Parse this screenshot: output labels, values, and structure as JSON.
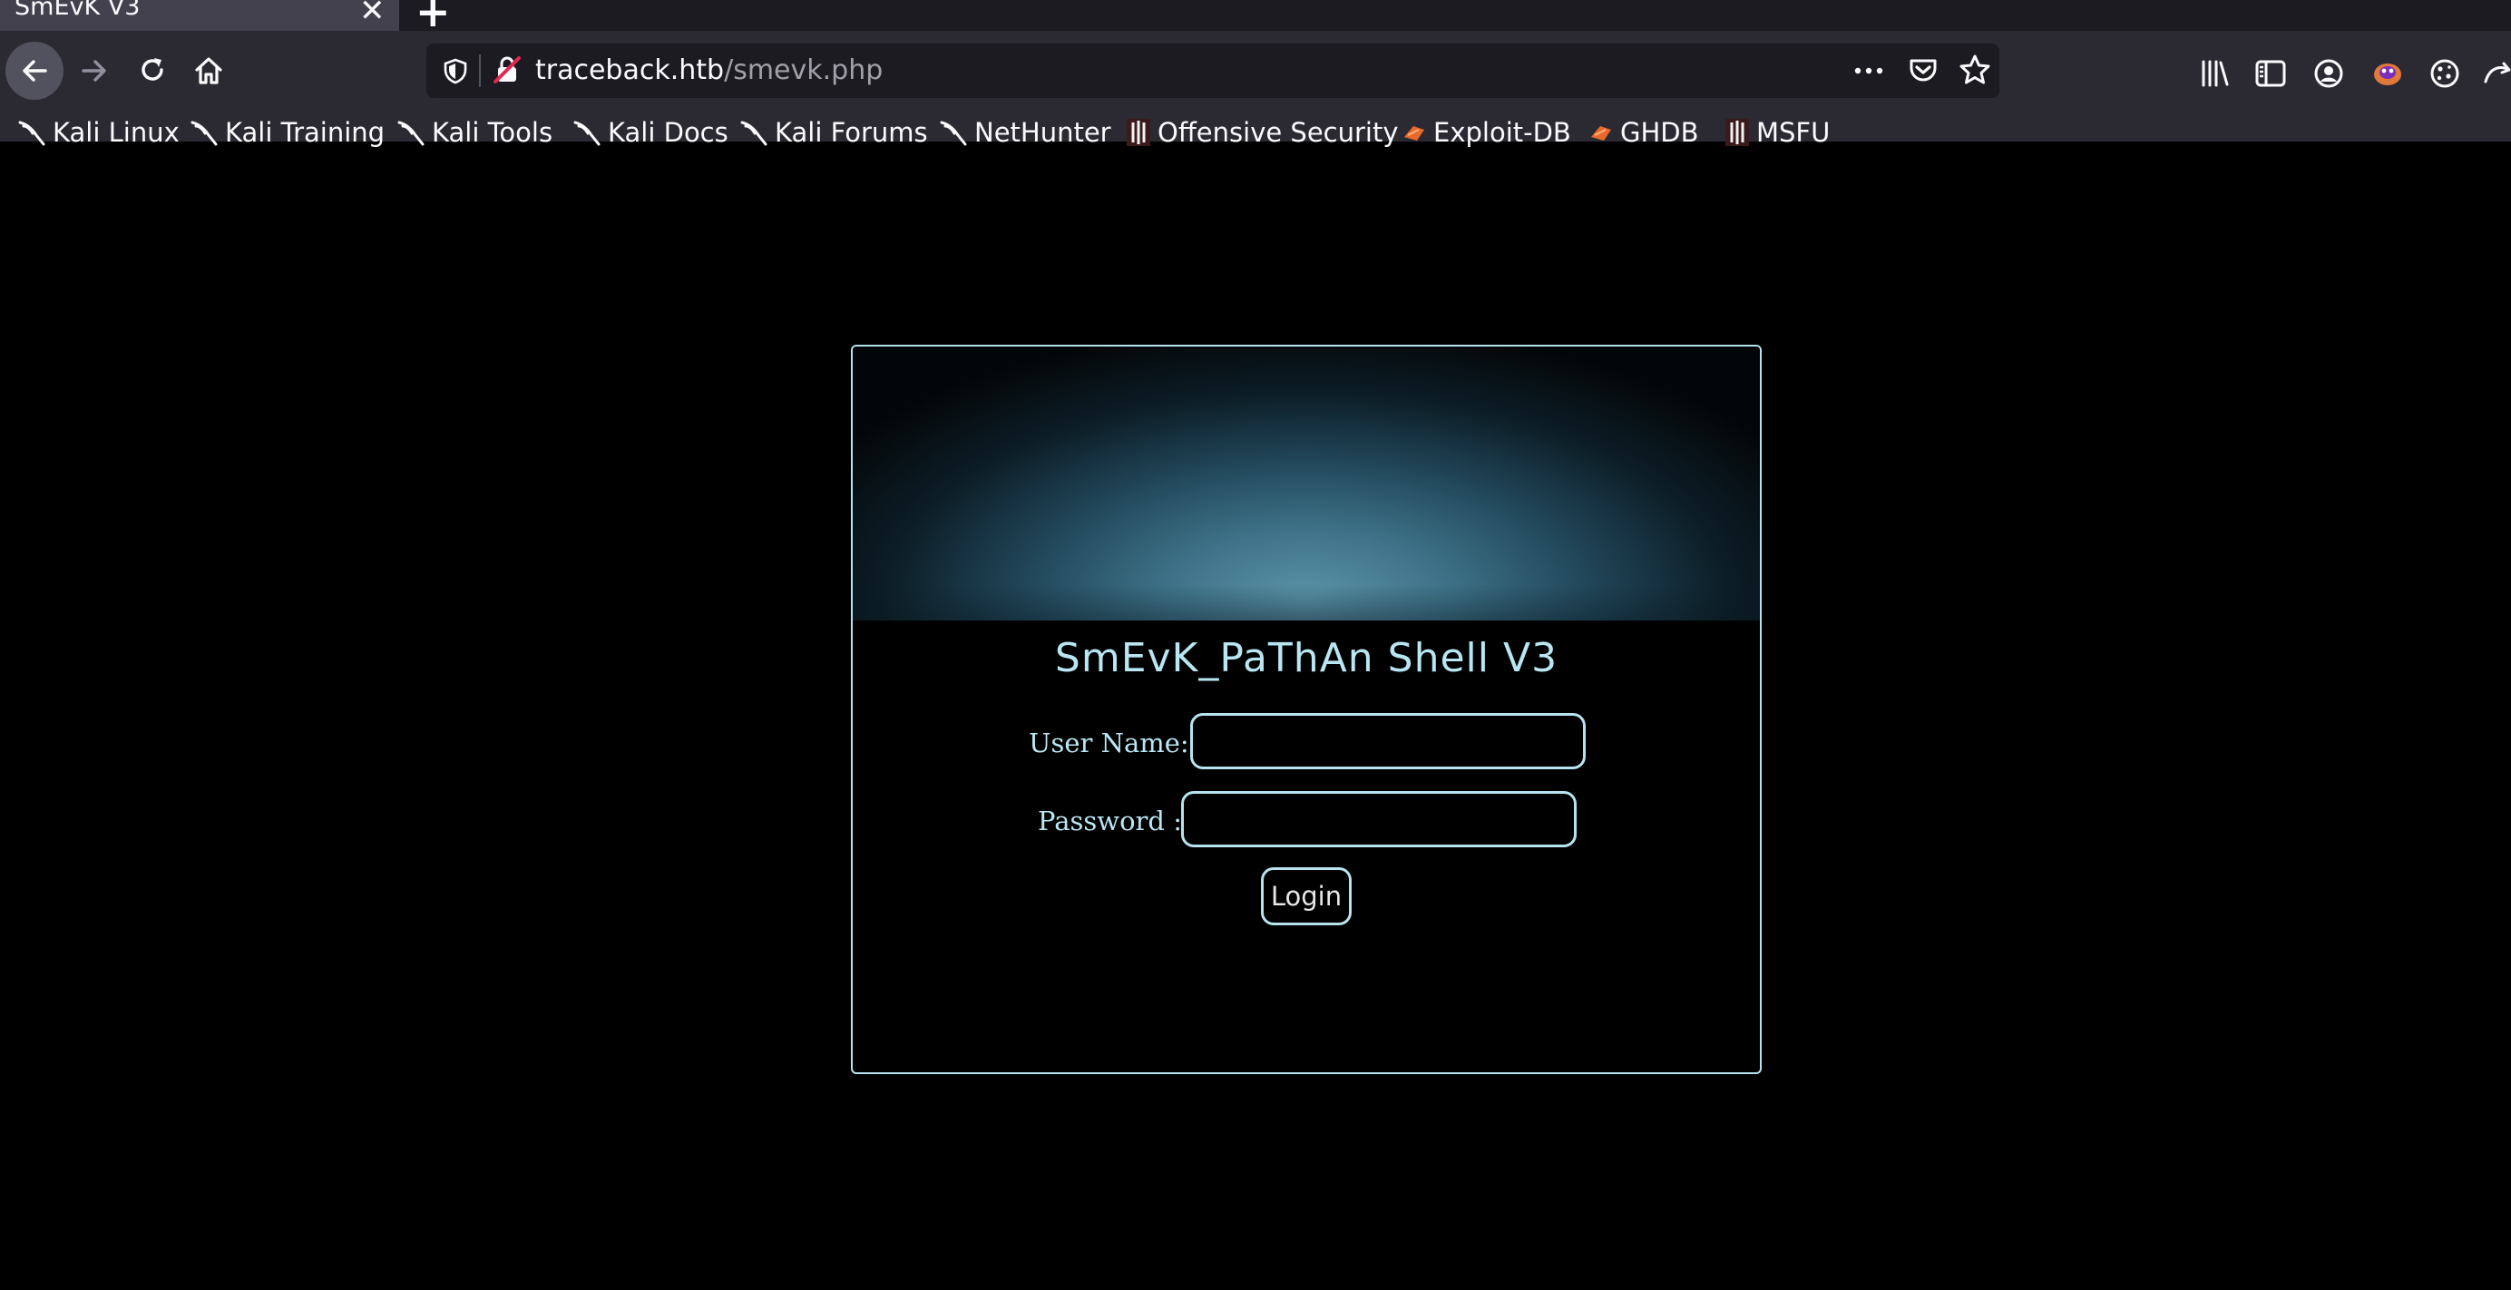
{
  "browser": {
    "tab": {
      "title": "SmEvK V3"
    },
    "url": {
      "host": "traceback.htb",
      "path": "/smevk.php"
    },
    "icons": [
      "back-arrow-icon",
      "forward-arrow-icon",
      "reload-icon",
      "home-icon",
      "shield-icon",
      "insecure-lock-icon",
      "more-actions-icon",
      "pocket-icon",
      "star-icon",
      "library-icon",
      "sidebar-icon",
      "account-icon",
      "extension-icon",
      "cookie-icon",
      "overflow-icon"
    ]
  },
  "bookmarks": [
    {
      "label": "Kali Linux",
      "icon": "kali-dragon-icon"
    },
    {
      "label": "Kali Training",
      "icon": "kali-dragon-icon"
    },
    {
      "label": "Kali Tools",
      "icon": "kali-dragon-icon"
    },
    {
      "label": "Kali Docs",
      "icon": "kali-dragon-icon"
    },
    {
      "label": "Kali Forums",
      "icon": "kali-dragon-icon"
    },
    {
      "label": "NetHunter",
      "icon": "kali-dragon-icon"
    },
    {
      "label": "Offensive Security",
      "icon": "offsec-icon"
    },
    {
      "label": "Exploit-DB",
      "icon": "exploitdb-icon"
    },
    {
      "label": "GHDB",
      "icon": "exploitdb-icon"
    },
    {
      "label": "MSFU",
      "icon": "offsec-icon"
    }
  ],
  "shell": {
    "title": "SmEvK_PaThAn Shell V3",
    "username_label": "User Name:",
    "username_value": "",
    "password_label": "Password :",
    "password_value": "",
    "login_label": "Login"
  },
  "colors": {
    "accent": "#b9e6f3",
    "toolbar": "#2b2a33",
    "tabstrip": "#1c1b22",
    "page": "#000000"
  }
}
